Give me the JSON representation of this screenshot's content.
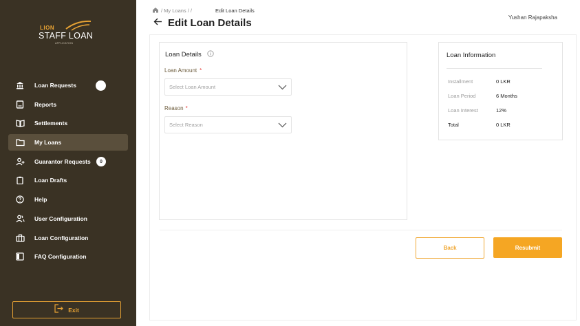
{
  "logo": {
    "line1": "LION",
    "line2": "STAFF LOAN",
    "line3": "APPLICATION"
  },
  "sidebar": {
    "items": [
      {
        "label": "Loan Requests",
        "icon": "bank-icon",
        "badge": ""
      },
      {
        "label": "Reports",
        "icon": "report-icon"
      },
      {
        "label": "Settlements",
        "icon": "book-icon"
      },
      {
        "label": "My Loans",
        "icon": "folder-icon",
        "active": true
      },
      {
        "label": "Guarantor Requests",
        "icon": "person-add-icon",
        "badge": "0"
      },
      {
        "label": "Loan Drafts",
        "icon": "clipboard-icon"
      },
      {
        "label": "Help",
        "icon": "help-icon"
      },
      {
        "label": "User Configuration",
        "icon": "users-icon"
      },
      {
        "label": "Loan Configuration",
        "icon": "briefcase-icon"
      },
      {
        "label": "FAQ Configuration",
        "icon": "panel-icon"
      }
    ],
    "exit_label": "Exit"
  },
  "breadcrumb": {
    "trail": "/ My Loans / /",
    "current": "Edit Loan Details"
  },
  "header": {
    "title": "Edit Loan Details",
    "user": "Yushan Rajapaksha"
  },
  "loan_details": {
    "title": "Loan Details",
    "amount_label": "Loan Amount",
    "amount_required": "*",
    "amount_placeholder": "Select Loan Amount",
    "reason_label": "Reason",
    "reason_required": "*",
    "reason_placeholder": "Select Reason"
  },
  "loan_info": {
    "title": "Loan Information",
    "rows": [
      {
        "key": "Installment",
        "value": "0 LKR"
      },
      {
        "key": "Loan Period",
        "value": "6 Months"
      },
      {
        "key": "Loan Interest",
        "value": "12%"
      },
      {
        "key": "Total",
        "value": "0 LKR"
      }
    ]
  },
  "actions": {
    "back": "Back",
    "resubmit": "Resubmit"
  },
  "colors": {
    "sidebar": "#3a3224",
    "accent": "#f5a623",
    "active_item": "#5a4f3c"
  }
}
